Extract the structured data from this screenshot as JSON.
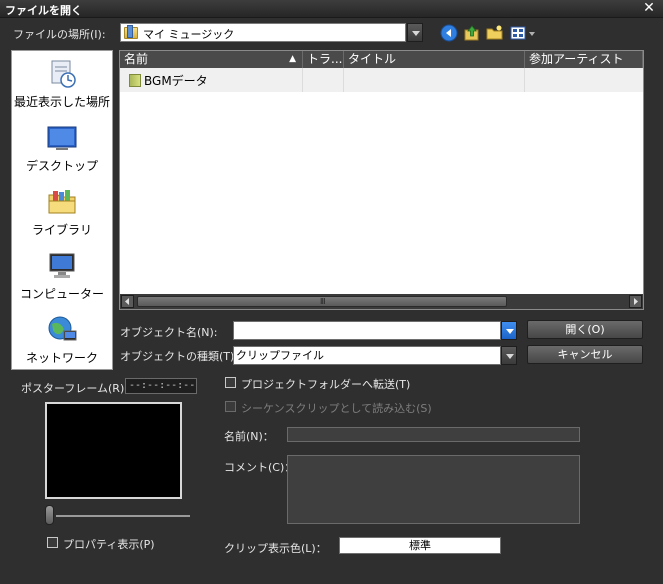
{
  "window": {
    "title": "ファイルを開く",
    "close_symbol": "✕"
  },
  "location": {
    "label": "ファイルの場所(I):",
    "value": "マイ ミュージック"
  },
  "places": [
    {
      "label": "最近表示した場所",
      "icon": "recent-places-icon"
    },
    {
      "label": "デスクトップ",
      "icon": "desktop-icon"
    },
    {
      "label": "ライブラリ",
      "icon": "library-icon"
    },
    {
      "label": "コンピューター",
      "icon": "computer-icon"
    },
    {
      "label": "ネットワーク",
      "icon": "network-icon"
    }
  ],
  "filelist": {
    "columns": [
      "名前",
      "トラ...",
      "タイトル",
      "参加アーティスト"
    ],
    "rows": [
      {
        "name": "BGMデータ"
      }
    ],
    "scroll_grip": "Ⅲ"
  },
  "object_name": {
    "label": "オブジェクト名(N):",
    "value": ""
  },
  "object_type": {
    "label": "オブジェクトの種類(T):",
    "value": "クリップファイル"
  },
  "buttons": {
    "open": "開く(O)",
    "cancel": "キャンセル"
  },
  "poster_frame": {
    "label": "ポスターフレーム(R)：",
    "timecode": "--:--:--:--"
  },
  "options": {
    "transfer_to_project": "プロジェクトフォルダーへ転送(T)",
    "load_as_sequence": "シーケンスクリップとして読み込む(S)",
    "show_properties": "プロパティ表示(P)"
  },
  "meta": {
    "name_label": "名前(N)：",
    "comment_label": "コメント(C)：",
    "clip_color_label": "クリップ表示色(L)：",
    "clip_color_value": "標準"
  }
}
